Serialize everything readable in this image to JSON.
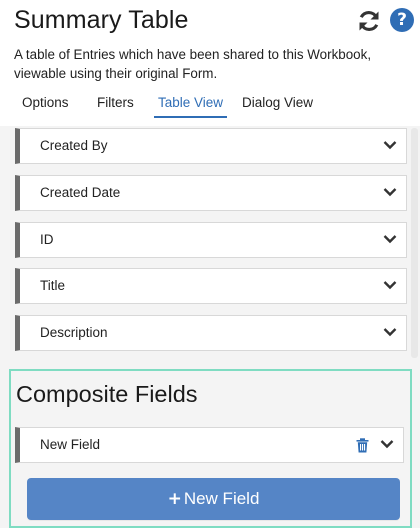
{
  "header": {
    "title": "Summary Table",
    "description": "A table of Entries which have been shared to this Workbook, viewable using their original Form.",
    "refresh_icon": "refresh-icon",
    "help_icon": "help-icon",
    "help_glyph": "?"
  },
  "tabs": [
    {
      "label": "Options",
      "active": false
    },
    {
      "label": "Filters",
      "active": false
    },
    {
      "label": "Table View",
      "active": true
    },
    {
      "label": "Dialog View",
      "active": false
    }
  ],
  "fields": [
    {
      "label": "Created By"
    },
    {
      "label": "Created Date"
    },
    {
      "label": "ID"
    },
    {
      "label": "Title"
    },
    {
      "label": "Description"
    }
  ],
  "composite": {
    "title": "Composite Fields",
    "fields": [
      {
        "label": "New Field"
      }
    ],
    "new_button_label": "New Field",
    "new_button_icon": "plus-icon"
  },
  "colors": {
    "accent": "#2f6db5",
    "button": "#5585c6",
    "highlight_border": "#7fdcc2",
    "row_marker": "#6b6b6b"
  }
}
